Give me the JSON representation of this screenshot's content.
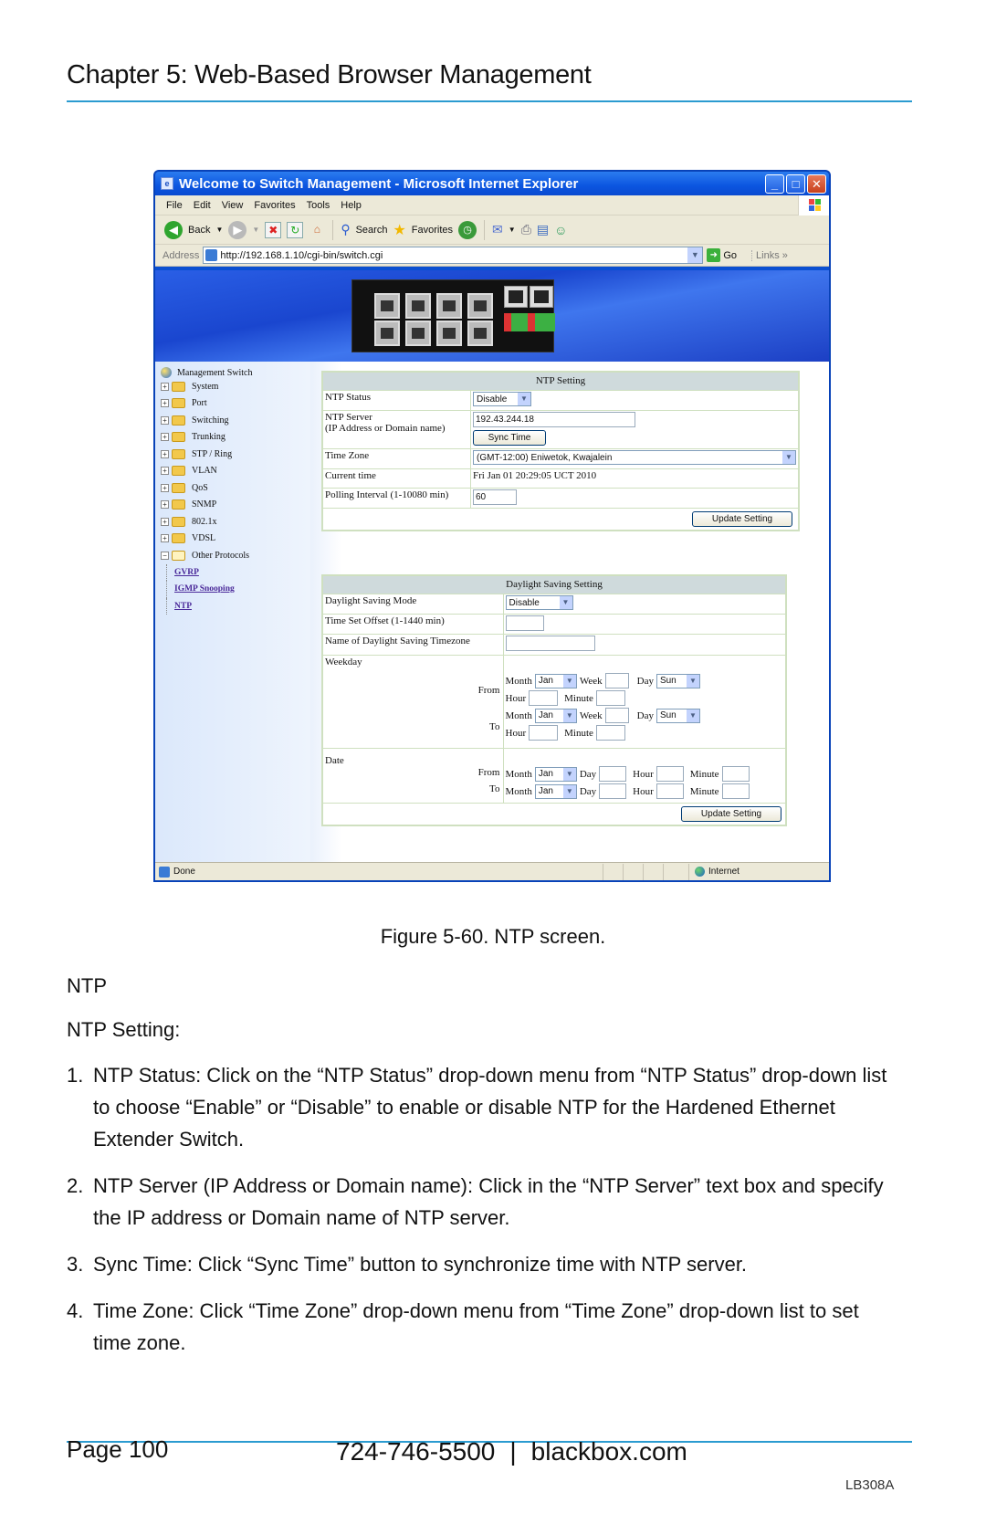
{
  "header": {
    "chapter_title": "Chapter 5: Web-Based Browser Management"
  },
  "browser": {
    "title": "Welcome to Switch Management - Microsoft Internet Explorer",
    "window_buttons": {
      "minimize": "_",
      "maximize": "□",
      "close": "✕"
    },
    "menu": [
      "File",
      "Edit",
      "View",
      "Favorites",
      "Tools",
      "Help"
    ],
    "toolbar": {
      "back": "Back",
      "search": "Search",
      "favorites": "Favorites"
    },
    "address": {
      "label": "Address",
      "url": "http://192.168.1.10/cgi-bin/switch.cgi",
      "go": "Go",
      "links": "Links »"
    },
    "status": {
      "text": "Done",
      "zone": "Internet"
    }
  },
  "sidebar": {
    "root": "Management Switch",
    "folders": [
      {
        "label": "System",
        "expanded": false
      },
      {
        "label": "Port",
        "expanded": false
      },
      {
        "label": "Switching",
        "expanded": false
      },
      {
        "label": "Trunking",
        "expanded": false
      },
      {
        "label": "STP / Ring",
        "expanded": false
      },
      {
        "label": "VLAN",
        "expanded": false
      },
      {
        "label": "QoS",
        "expanded": false
      },
      {
        "label": "SNMP",
        "expanded": false
      },
      {
        "label": "802.1x",
        "expanded": false
      },
      {
        "label": "VDSL",
        "expanded": false
      },
      {
        "label": "Other Protocols",
        "expanded": true
      }
    ],
    "links": [
      "GVRP",
      "IGMP Snooping",
      "NTP"
    ]
  },
  "ntp_setting": {
    "title": "NTP Setting",
    "status_label": "NTP Status",
    "status_value": "Disable",
    "server_label_1": "NTP Server",
    "server_label_2": "(IP Address or Domain name)",
    "server_value": "192.43.244.18",
    "sync_button": "Sync Time",
    "timezone_label": "Time Zone",
    "timezone_value": "(GMT-12:00) Eniwetok, Kwajalein",
    "current_time_label": "Current time",
    "current_time_value": "Fri Jan 01 20:29:05 UCT 2010",
    "polling_label": "Polling Interval (1-10080 min)",
    "polling_value": "60",
    "update_button": "Update Setting"
  },
  "dst_setting": {
    "title": "Daylight Saving Setting",
    "mode_label": "Daylight Saving Mode",
    "mode_value": "Disable",
    "offset_label": "Time Set Offset (1-1440 min)",
    "offset_value": "",
    "name_label": "Name of Daylight Saving Timezone",
    "name_value": "",
    "weekday_label": "Weekday",
    "date_label": "Date",
    "from": "From",
    "to": "To",
    "month": "Month",
    "week": "Week",
    "day": "Day",
    "hour": "Hour",
    "minute": "Minute",
    "month_value": "Jan",
    "day_value": "Sun",
    "update_button": "Update Setting"
  },
  "figure_caption": "Figure 5-60. NTP screen.",
  "section_heading": "NTP",
  "intro": "NTP Setting:",
  "steps": [
    {
      "num": "1.",
      "text": "NTP Status: Click on the “NTP Status” drop-down menu from “NTP Status” drop-down list to choose “Enable” or “Disable” to enable or disable NTP for the Hardened Ethernet Extender Switch."
    },
    {
      "num": "2.",
      "text": "NTP Server (IP Address or Domain name): Click in the “NTP Server” text box and specify the IP address or Domain name of NTP server."
    },
    {
      "num": "3.",
      "text": "Sync Time: Click “Sync Time” button to synchronize time with NTP server."
    },
    {
      "num": "4.",
      "text": "Time Zone: Click “Time Zone” drop-down menu from “Time Zone” drop-down list to set time zone."
    }
  ],
  "footer": {
    "page": "Page 100",
    "phone": "724-746-5500",
    "separator": "|",
    "website": "blackbox.com",
    "doc_code": "LB308A"
  },
  "colors": {
    "accent_rule": "#2b9bd0",
    "xp_titlebar": "#0b55e0",
    "link_purple": "#4b2a9a"
  }
}
